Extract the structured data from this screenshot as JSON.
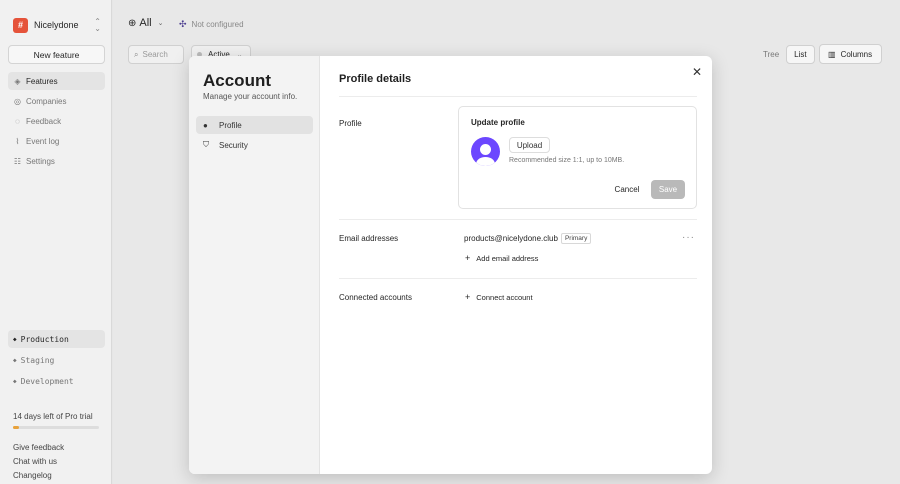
{
  "workspace": {
    "logo_letter": "#",
    "name": "Nicelydone"
  },
  "sidebar": {
    "new_feature": "New feature",
    "items": [
      {
        "label": "Features",
        "icon": "layers-icon"
      },
      {
        "label": "Companies",
        "icon": "globe-icon"
      },
      {
        "label": "Feedback",
        "icon": "chat-icon"
      },
      {
        "label": "Event log",
        "icon": "pulse-icon"
      },
      {
        "label": "Settings",
        "icon": "settings-icon"
      }
    ],
    "environments": [
      "Production",
      "Staging",
      "Development"
    ],
    "trial_text": "14 days left of Pro trial",
    "trial_progress": 0.07,
    "footer_links": [
      "Give feedback",
      "Chat with us",
      "Changelog"
    ],
    "colors": {
      "logo": "#e5533a",
      "trial": "#e8a23b"
    }
  },
  "toolbar": {
    "scope": "All",
    "integration_status": "Not configured",
    "search_placeholder": "Search",
    "filter": "Active",
    "views": [
      "Tree",
      "List"
    ],
    "columns": "Columns"
  },
  "modal": {
    "title": "Account",
    "subtitle": "Manage your account info.",
    "nav": [
      "Profile",
      "Security"
    ],
    "section_title": "Profile details",
    "profile_label": "Profile",
    "card_title": "Update profile",
    "upload": "Upload",
    "upload_hint": "Recommended size 1:1, up to 10MB.",
    "cancel": "Cancel",
    "save": "Save",
    "email_label": "Email addresses",
    "email": "products@nicelydone.club",
    "email_badge": "Primary",
    "add_email": "Add email address",
    "connected_label": "Connected accounts",
    "connect": "Connect account",
    "accent": "#6c47ff"
  }
}
